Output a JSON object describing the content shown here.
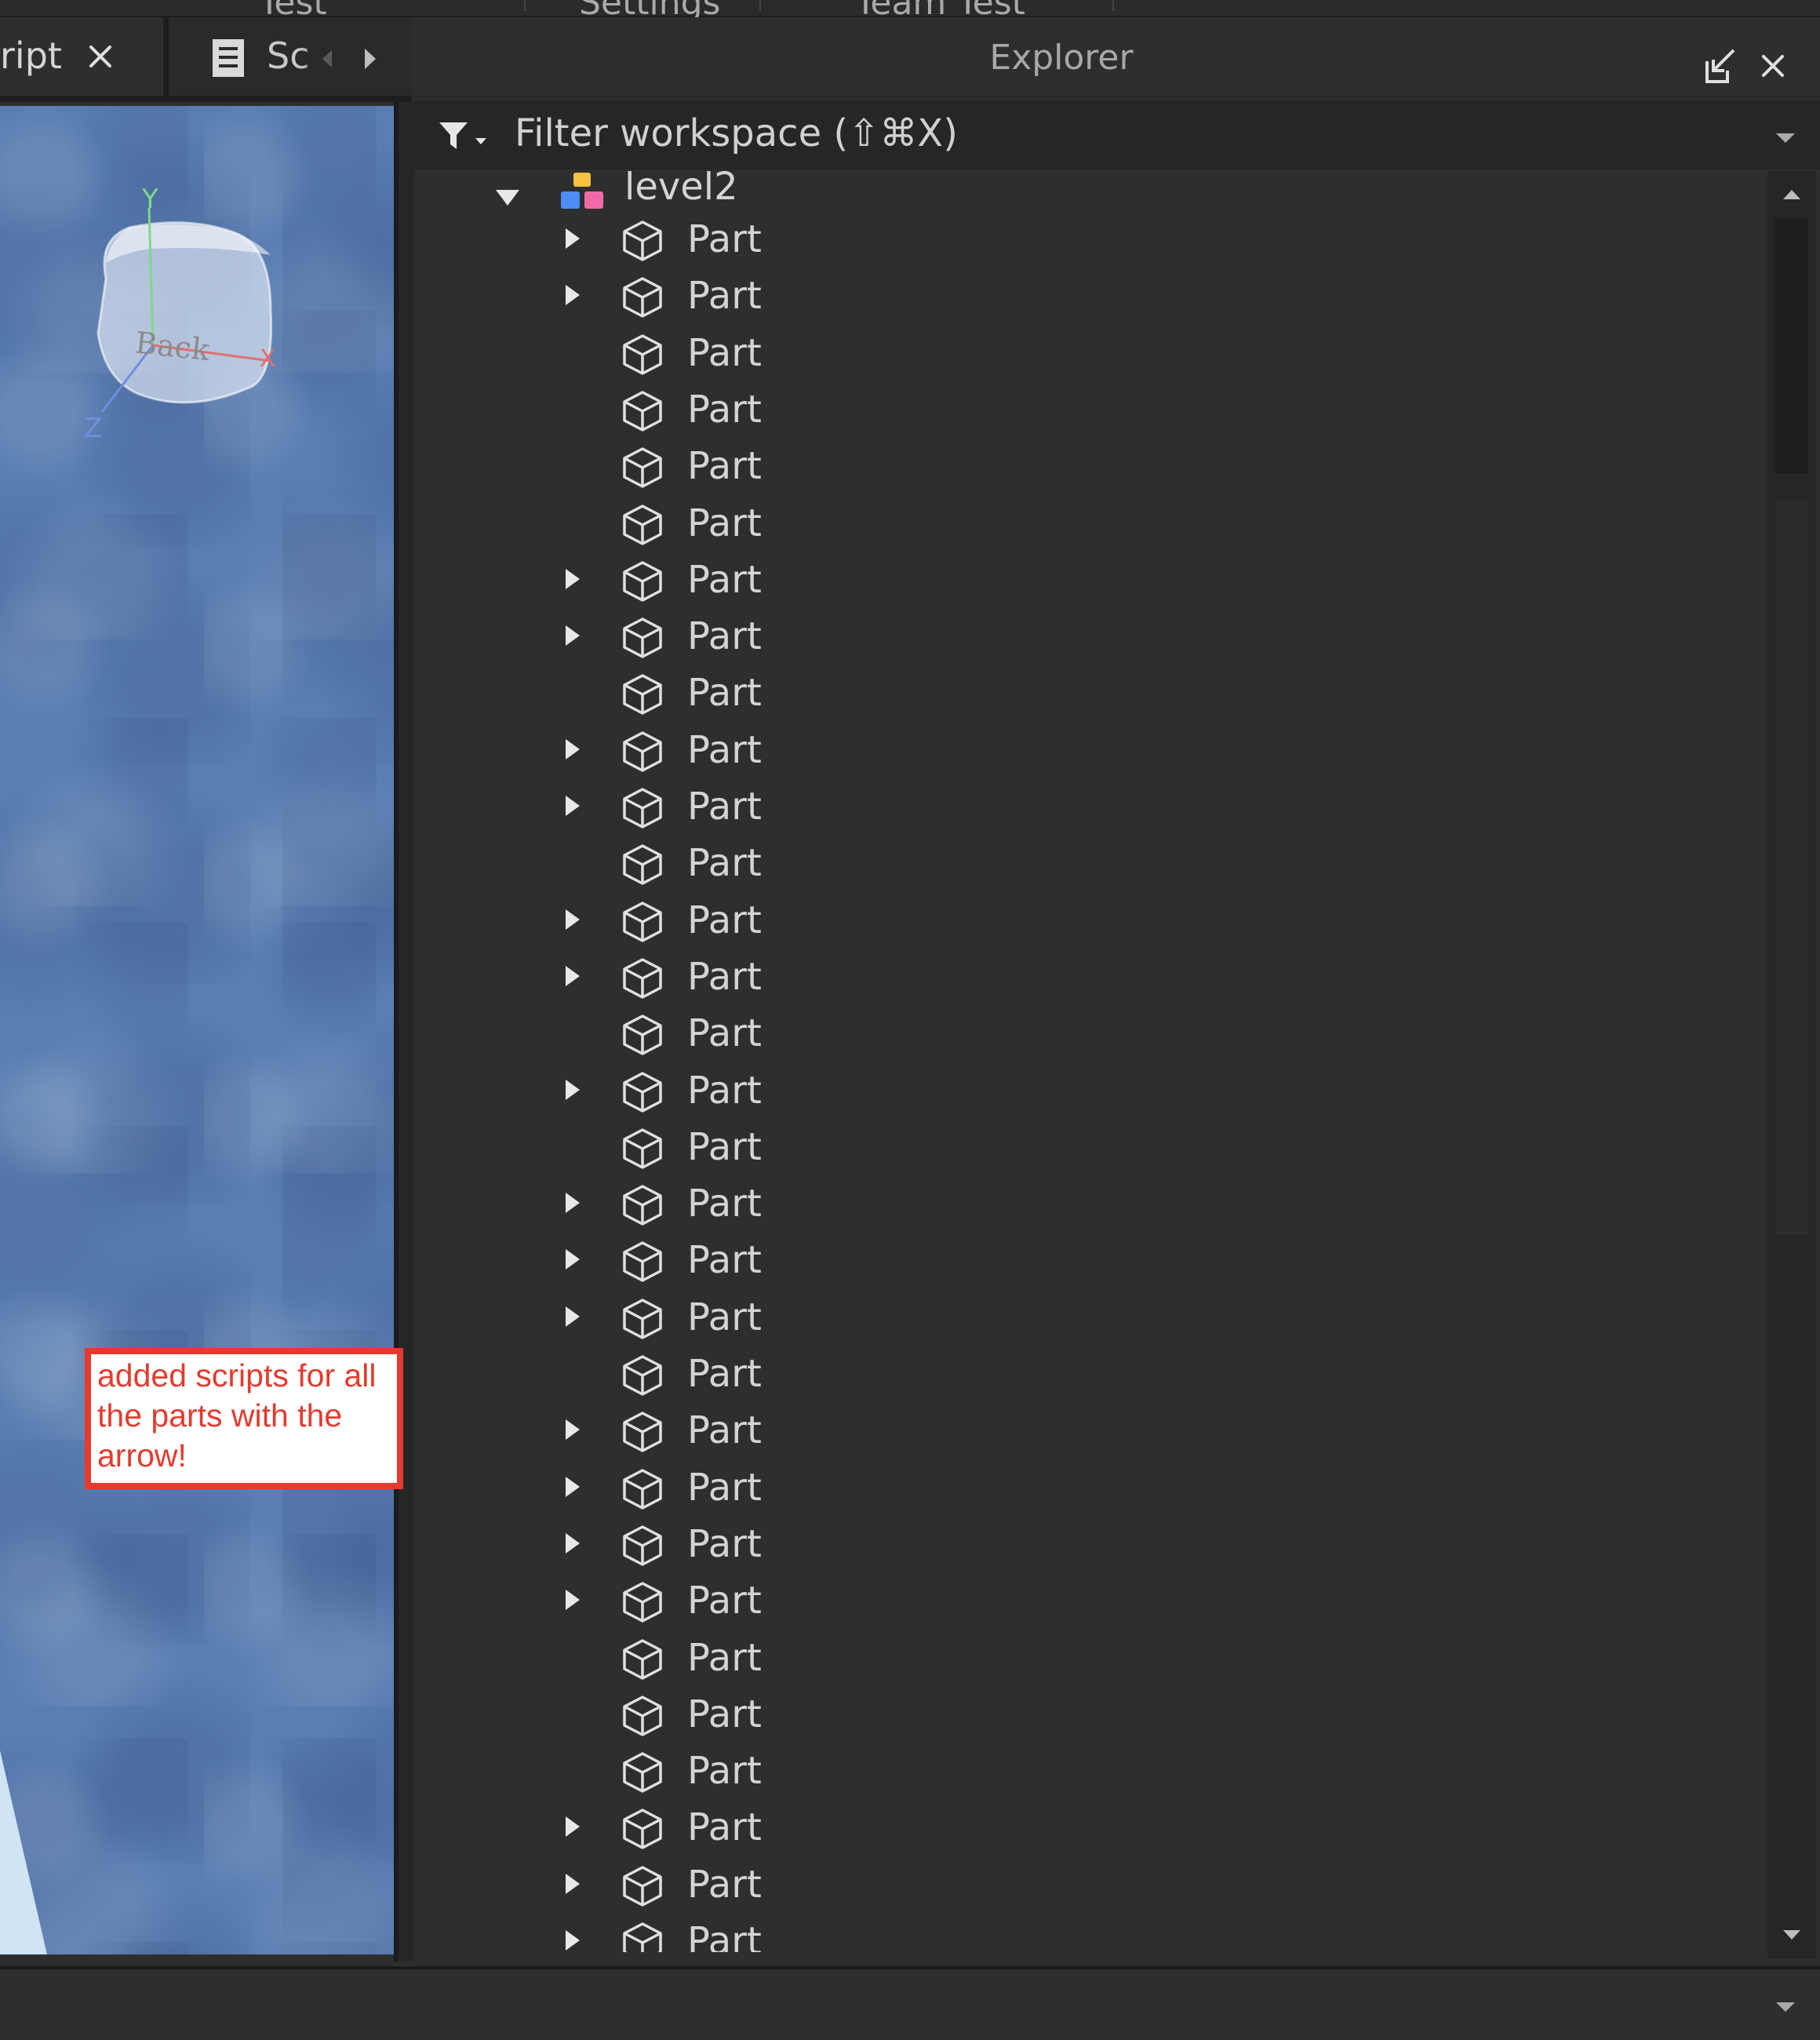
{
  "top_tabs": [
    "Test",
    "Settings",
    "Team Test"
  ],
  "editor_tabs": {
    "tab1_label": "ript",
    "tab2_label": "Sc"
  },
  "viewport": {
    "cube_face_label": "Back",
    "axes": {
      "y": "Y",
      "x": "X",
      "z": "Z"
    }
  },
  "annotation_note": "added scripts for all the parts with the arrow!",
  "explorer": {
    "title": "Explorer",
    "filter_placeholder": "Filter workspace (⇧⌘X)",
    "model": {
      "name": "level2",
      "expanded": true
    },
    "items": [
      {
        "label": "Part",
        "has_children": true
      },
      {
        "label": "Part",
        "has_children": true
      },
      {
        "label": "Part",
        "has_children": false
      },
      {
        "label": "Part",
        "has_children": false
      },
      {
        "label": "Part",
        "has_children": false
      },
      {
        "label": "Part",
        "has_children": false
      },
      {
        "label": "Part",
        "has_children": true
      },
      {
        "label": "Part",
        "has_children": true
      },
      {
        "label": "Part",
        "has_children": false
      },
      {
        "label": "Part",
        "has_children": true
      },
      {
        "label": "Part",
        "has_children": true
      },
      {
        "label": "Part",
        "has_children": false
      },
      {
        "label": "Part",
        "has_children": true
      },
      {
        "label": "Part",
        "has_children": true
      },
      {
        "label": "Part",
        "has_children": false
      },
      {
        "label": "Part",
        "has_children": true
      },
      {
        "label": "Part",
        "has_children": false
      },
      {
        "label": "Part",
        "has_children": true
      },
      {
        "label": "Part",
        "has_children": true
      },
      {
        "label": "Part",
        "has_children": true
      },
      {
        "label": "Part",
        "has_children": false
      },
      {
        "label": "Part",
        "has_children": true
      },
      {
        "label": "Part",
        "has_children": true
      },
      {
        "label": "Part",
        "has_children": true
      },
      {
        "label": "Part",
        "has_children": true
      },
      {
        "label": "Part",
        "has_children": false
      },
      {
        "label": "Part",
        "has_children": false
      },
      {
        "label": "Part",
        "has_children": false
      },
      {
        "label": "Part",
        "has_children": true
      },
      {
        "label": "Part",
        "has_children": true
      },
      {
        "label": "Part",
        "has_children": true
      }
    ]
  },
  "icons": {
    "tab_close": "close-icon",
    "script": "script-icon",
    "undock": "undock-icon",
    "panel_close": "close-icon",
    "filter": "filter-icon",
    "model": "model-icon",
    "part": "part-icon",
    "expand": "caret-right-icon",
    "collapse": "caret-down-icon"
  },
  "colors": {
    "panel_bg": "#2e2e2e",
    "note_red": "#e33b2e",
    "viewport_blue": "#5a7eb2"
  }
}
